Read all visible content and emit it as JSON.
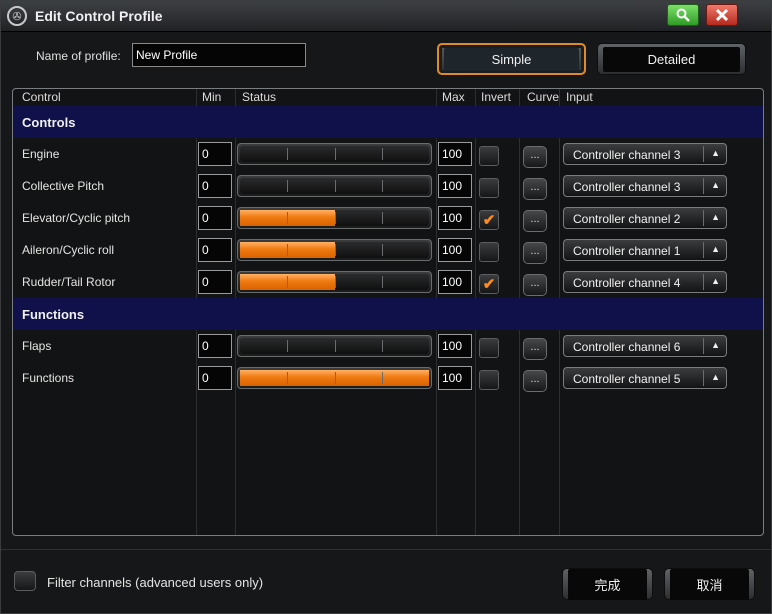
{
  "window": {
    "title": "Edit Control Profile",
    "title_icon": "helicopter-icon",
    "search_icon": "search-icon",
    "close_icon": "close-icon"
  },
  "profile": {
    "name_label": "Name of profile:",
    "name_value": "New Profile"
  },
  "modes": {
    "simple": "Simple",
    "detailed": "Detailed",
    "active": "Simple"
  },
  "table": {
    "headers": {
      "control": "Control",
      "min": "Min",
      "status": "Status",
      "max": "Max",
      "invert": "Invert",
      "curve": "Curve",
      "input": "Input"
    },
    "sections": [
      {
        "label": "Controls",
        "rows": [
          {
            "label": "Engine",
            "min": "0",
            "max": "100",
            "status": 0.0,
            "invert": false,
            "curve": "...",
            "input": "Controller channel 3"
          },
          {
            "label": "Collective Pitch",
            "min": "0",
            "max": "100",
            "status": 0.0,
            "invert": false,
            "curve": "...",
            "input": "Controller channel 3"
          },
          {
            "label": "Elevator/Cyclic pitch",
            "min": "0",
            "max": "100",
            "status": 0.5,
            "invert": true,
            "curve": "...",
            "input": "Controller channel 2"
          },
          {
            "label": "Aileron/Cyclic roll",
            "min": "0",
            "max": "100",
            "status": 0.5,
            "invert": false,
            "curve": "...",
            "input": "Controller channel 1"
          },
          {
            "label": "Rudder/Tail Rotor",
            "min": "0",
            "max": "100",
            "status": 0.5,
            "invert": true,
            "curve": "...",
            "input": "Controller channel 4"
          }
        ]
      },
      {
        "label": "Functions",
        "rows": [
          {
            "label": "Flaps",
            "min": "0",
            "max": "100",
            "status": 0.0,
            "invert": false,
            "curve": "...",
            "input": "Controller channel 6"
          },
          {
            "label": "Functions",
            "min": "0",
            "max": "100",
            "status": 1.0,
            "invert": false,
            "curve": "...",
            "input": "Controller channel 5"
          }
        ]
      }
    ]
  },
  "footer": {
    "filter_label": "Filter channels (advanced users only)",
    "filter_checked": false,
    "ok": "完成",
    "cancel": "取消"
  },
  "colors": {
    "accent": "#f07a10",
    "section_bg": "#10104a"
  }
}
